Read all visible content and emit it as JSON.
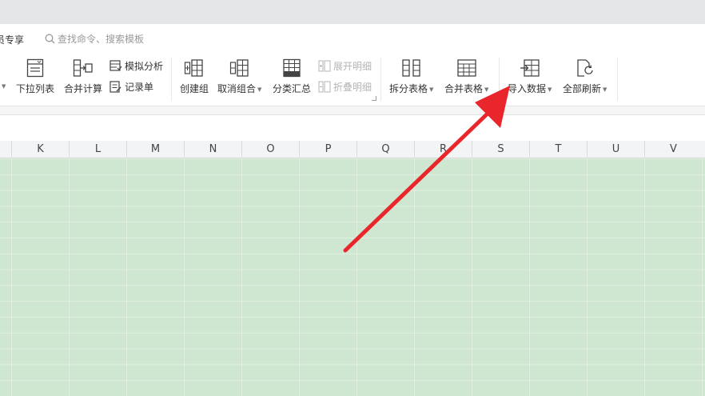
{
  "menubar": {
    "member_tab": "员专享",
    "search_placeholder": "查找命令、搜索模板"
  },
  "ribbon": {
    "dropdown_list": "下拉列表",
    "consolidate": "合并计算",
    "simulation_analysis": "模拟分析",
    "record_form": "记录单",
    "create_group": "创建组",
    "ungroup": "取消组合",
    "subtotal": "分类汇总",
    "expand_detail": "展开明细",
    "collapse_detail": "折叠明细",
    "split_table": "拆分表格",
    "merge_table": "合并表格",
    "import_data": "导入数据",
    "refresh_all": "全部刷新"
  },
  "columns": [
    "K",
    "L",
    "M",
    "N",
    "O",
    "P",
    "Q",
    "R",
    "S",
    "T",
    "U",
    "V"
  ],
  "colors": {
    "grid_fill": "#cfe7d0",
    "arrow": "#e8262b"
  }
}
